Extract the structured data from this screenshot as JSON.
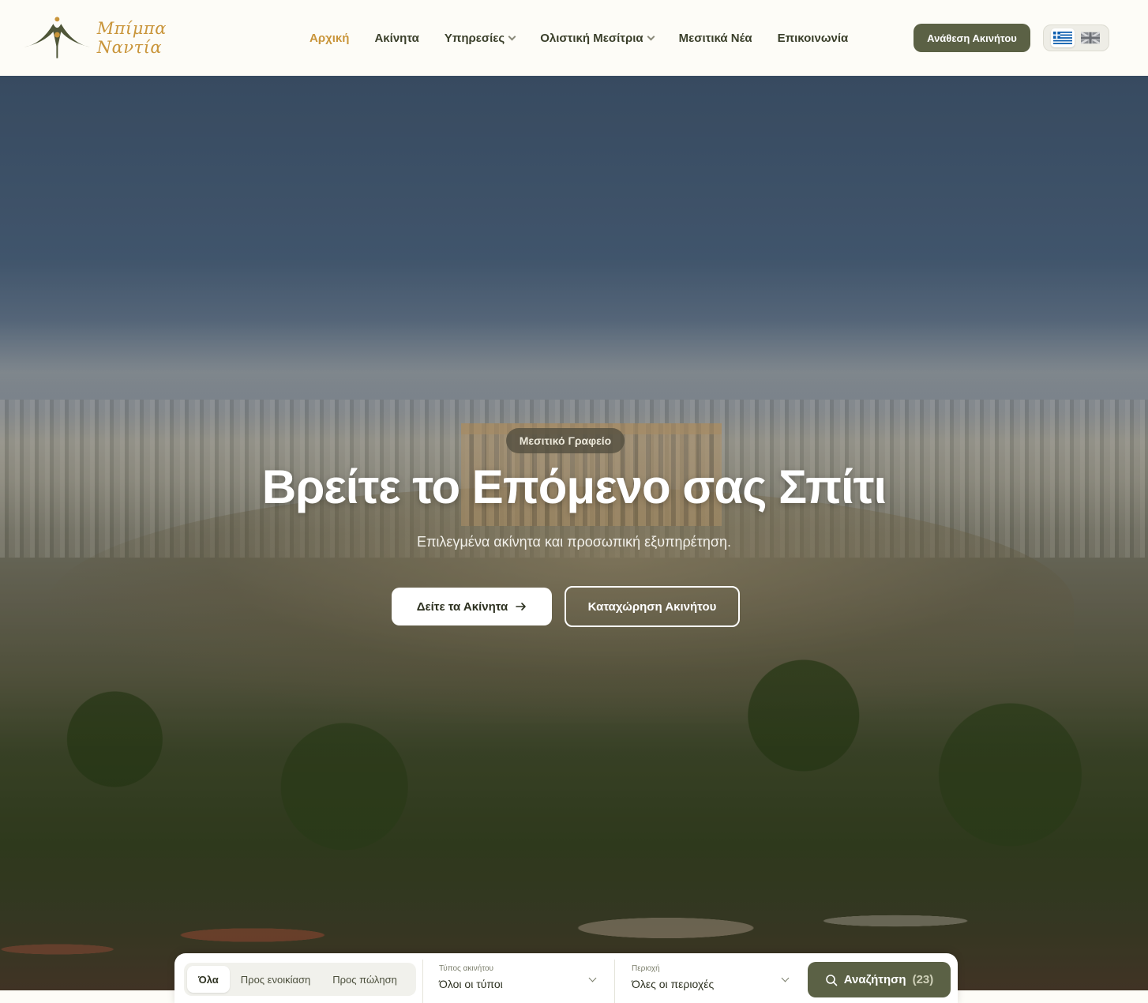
{
  "brand": {
    "name": "Μπίμπα Ναντία",
    "accent": "#c9953a",
    "primary": "#5b6145"
  },
  "nav": {
    "items": [
      {
        "label": "Αρχική",
        "active": true,
        "dropdown": false
      },
      {
        "label": "Ακίνητα",
        "active": false,
        "dropdown": false
      },
      {
        "label": "Υπηρεσίες",
        "active": false,
        "dropdown": true
      },
      {
        "label": "Ολιστική Μεσίτρια",
        "active": false,
        "dropdown": true
      },
      {
        "label": "Μεσιτικά Νέα",
        "active": false,
        "dropdown": false
      },
      {
        "label": "Επικοινωνία",
        "active": false,
        "dropdown": false
      }
    ],
    "cta_label": "Ανάθεση Ακινήτου",
    "languages": [
      {
        "code": "el",
        "icon": "greek-flag-icon",
        "selected": true
      },
      {
        "code": "en",
        "icon": "uk-flag-icon",
        "selected": false
      }
    ]
  },
  "hero": {
    "badge": "Μεσιτικό Γραφείο",
    "title": "Βρείτε το Επόμενο σας Σπίτι",
    "subtitle": "Επιλεγμένα ακίνητα και προσωπική εξυπηρέτηση.",
    "primary_button": "Δείτε τα Ακίνητα",
    "secondary_button": "Καταχώρηση Ακινήτου"
  },
  "search": {
    "tabs": [
      {
        "label": "Όλα",
        "selected": true
      },
      {
        "label": "Προς ενοικίαση",
        "selected": false
      },
      {
        "label": "Προς πώληση",
        "selected": false
      }
    ],
    "type_label": "Τύπος ακινήτου",
    "type_value": "Όλοι οι τύποι",
    "area_label": "Περιοχή",
    "area_value": "Όλες οι περιοχές",
    "button_label": "Αναζήτηση",
    "result_count": "(23)"
  }
}
